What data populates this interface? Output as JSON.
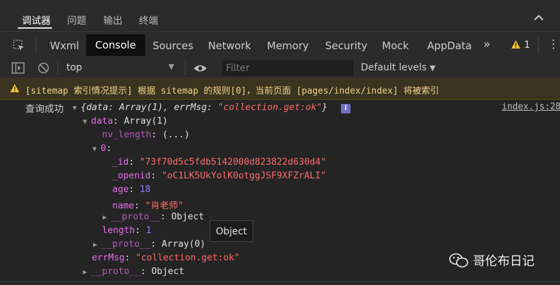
{
  "drawer": {
    "tabs": [
      "调试器",
      "问题",
      "输出",
      "终端"
    ],
    "active_index": 0
  },
  "panel_tabs": {
    "items": [
      "Wxml",
      "Console",
      "Sources",
      "Network",
      "Memory",
      "Security",
      "Mock",
      "AppData"
    ],
    "active": "Console",
    "more": "»",
    "warning_count": "1",
    "menu": "⋮"
  },
  "toolbar": {
    "context": "top",
    "filter_placeholder": "Filter",
    "levels": "Default levels"
  },
  "warning": {
    "text": "[sitemap 索引情况提示] 根据 sitemap 的规则[0]，当前页面 [pages/index/index] 将被索引"
  },
  "log": {
    "label": "查询成功",
    "summary_open": "{",
    "summary_data_key": "data",
    "summary_data_val": "Array(1)",
    "summary_err_key": "errMsg",
    "summary_err_val": "\"collection.get:ok\"",
    "summary_close": "}",
    "source": "index.js:28",
    "data_key": "data",
    "data_val": "Array(1)",
    "nv_key": "nv_length",
    "nv_val": "(...)",
    "idx_key": "0",
    "id_key": "_id",
    "id_val": "\"73f70d5c5fdb5142000d823822d630d4\"",
    "openid_key": "_openid",
    "openid_val": "\"oC1LK5UkYolK0otggJSF9XFZrALI\"",
    "age_key": "age",
    "age_val": "18",
    "name_key": "name",
    "name_q1": "\"",
    "name_val": "肖老师",
    "name_q2": "\"",
    "proto_key": "__proto__",
    "proto_obj": "Object",
    "length_key": "length",
    "length_val": "1",
    "proto_arr_key": "__proto__",
    "proto_arr_val": "Array(0)",
    "errmsg_key": "errMsg",
    "errmsg_val": "\"collection.get:ok\"",
    "proto_root_key": "__proto__",
    "proto_root_val": "Object"
  },
  "tooltip": "Object",
  "watermark": "哥伦布日记",
  "colors": {
    "background": "#242424",
    "toolbar": "#2b2b2b",
    "warning_bg": "#3a3320",
    "warning_text": "#f0d48a",
    "key": "#e36eec",
    "string": "#f28b54",
    "number": "#9980ff"
  }
}
